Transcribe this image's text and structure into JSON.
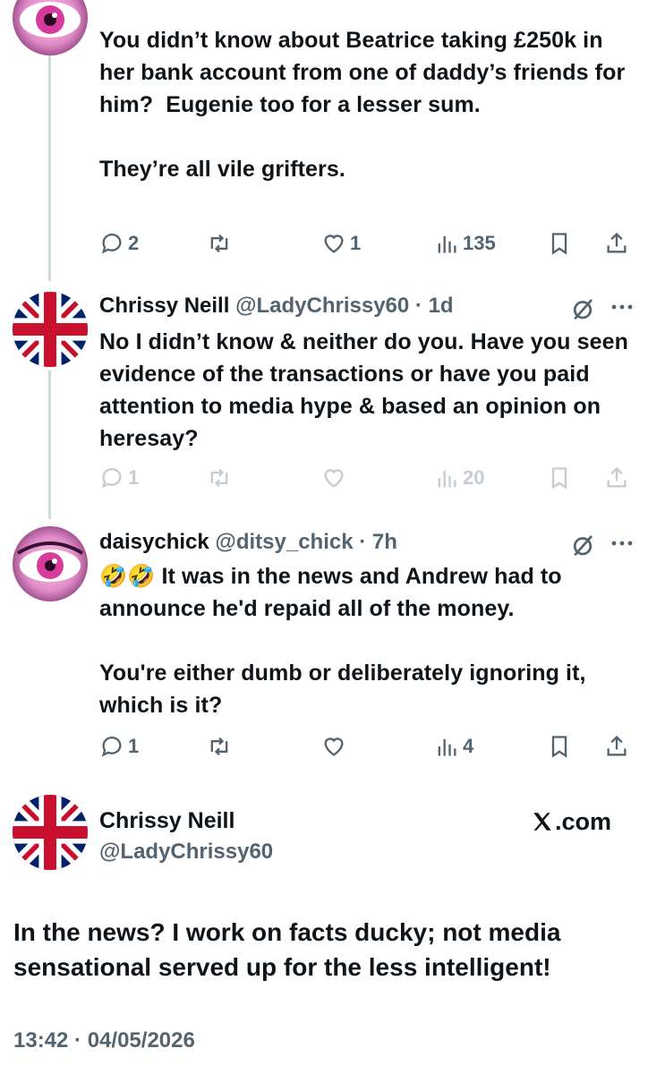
{
  "tweets": [
    {
      "body": "You didn’t know about Beatrice taking £250k in her bank account from one of daddy’s friends for him?  Eugenie too for a lesser sum.\n\nThey’re all vile grifters.",
      "replies": "2",
      "retweets": "",
      "likes": "1",
      "views": "135"
    },
    {
      "name": "Chrissy Neill",
      "handle": "@LadyChrissy60",
      "time": "· 1d",
      "body": "No I didn’t know & neither do you. Have you seen evidence of the transactions or have you paid attention to media hype & based an opinion on heresay?",
      "replies": "1",
      "retweets": "",
      "likes": "",
      "views": "20"
    },
    {
      "name": "daisychick",
      "handle": "@ditsy_chick",
      "time": "· 7h",
      "emoji": "🤣🤣",
      "body": "It was in the news and Andrew had to announce he'd repaid all of the money.\n\nYou're either dumb or deliberately ignoring it, which is it?",
      "replies": "1",
      "retweets": "",
      "likes": "",
      "views": "4"
    }
  ],
  "main": {
    "name": "Chrissy Neill",
    "handle": "@LadyChrissy60",
    "brand": ".com",
    "body": "In the news? I work on facts ducky; not media sensational served up for the less intelligent!",
    "timestamp": "13:42 · 04/05/2026"
  },
  "icons": {
    "reply": "speech-bubble-icon",
    "retweet": "retweet-arrows-icon",
    "like": "heart-icon",
    "views": "bar-chart-icon",
    "bookmark": "bookmark-icon",
    "share": "share-upload-icon",
    "grok": "slashed-circle-icon",
    "more": "ellipsis-icon"
  },
  "colors": {
    "text": "#0f1419",
    "muted": "#536471",
    "line": "#cfd9de",
    "union_blue": "#012169",
    "union_red": "#C8102E"
  }
}
